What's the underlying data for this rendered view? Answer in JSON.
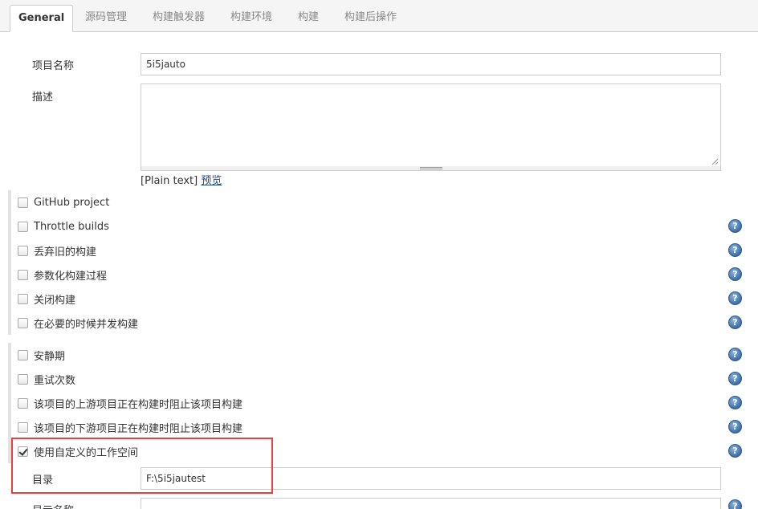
{
  "tabs": [
    {
      "label": "General",
      "active": true
    },
    {
      "label": "源码管理"
    },
    {
      "label": "构建触发器"
    },
    {
      "label": "构建环境"
    },
    {
      "label": "构建"
    },
    {
      "label": "构建后操作"
    }
  ],
  "general": {
    "project_name_label": "项目名称",
    "project_name_value": "5i5jauto",
    "description_label": "描述",
    "description_value": "",
    "format_hint": "[Plain text]",
    "preview_link": "预览"
  },
  "options_group1": [
    {
      "label": "GitHub project",
      "checked": false,
      "help": false
    },
    {
      "label": "Throttle builds",
      "checked": false,
      "help": true
    },
    {
      "label": "丢弃旧的构建",
      "checked": false,
      "help": true
    },
    {
      "label": "参数化构建过程",
      "checked": false,
      "help": true
    },
    {
      "label": "关闭构建",
      "checked": false,
      "help": true
    },
    {
      "label": "在必要的时候并发构建",
      "checked": false,
      "help": true
    }
  ],
  "options_group2": [
    {
      "label": "安静期",
      "checked": false,
      "help": true
    },
    {
      "label": "重试次数",
      "checked": false,
      "help": true
    },
    {
      "label": "该项目的上游项目正在构建时阻止该项目构建",
      "checked": false,
      "help": true
    },
    {
      "label": "该项目的下游项目正在构建时阻止该项目构建",
      "checked": false,
      "help": true
    },
    {
      "label": "使用自定义的工作空间",
      "checked": true,
      "help": true
    }
  ],
  "custom_workspace": {
    "directory_label": "目录",
    "directory_value": "F:\\5i5jautest",
    "display_name_label": "显示名称",
    "display_name_value": ""
  },
  "help_icon_glyph": "?",
  "colors": {
    "highlight": "#e8413a",
    "link": "#204a87",
    "help_icon": "#3c6ea8"
  }
}
